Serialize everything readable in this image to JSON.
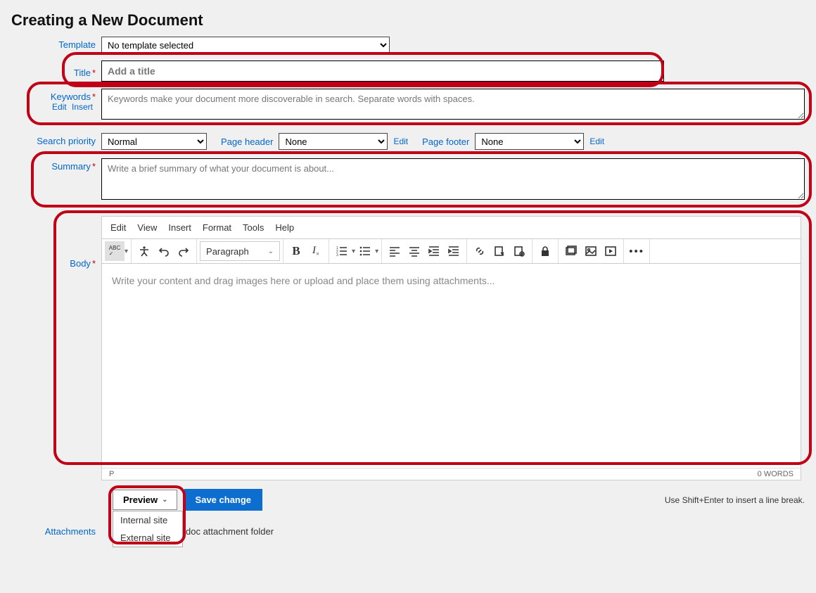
{
  "page_title": "Creating a New Document",
  "labels": {
    "template": "Template",
    "title": "Title",
    "keywords": "Keywords",
    "keywords_edit": "Edit",
    "keywords_insert": "Insert",
    "search_priority": "Search priority",
    "page_header": "Page header",
    "page_footer": "Page footer",
    "header_edit": "Edit",
    "footer_edit": "Edit",
    "summary": "Summary",
    "body": "Body",
    "attachments": "Attachments"
  },
  "template_select": {
    "selected": "No template selected"
  },
  "title_field": {
    "placeholder": "Add a title",
    "value": ""
  },
  "keywords_field": {
    "placeholder": "Keywords make your document more discoverable in search. Separate words with spaces.",
    "value": ""
  },
  "search_priority_select": {
    "selected": "Normal"
  },
  "page_header_select": {
    "selected": "None"
  },
  "page_footer_select": {
    "selected": "None"
  },
  "summary_field": {
    "placeholder": "Write a brief summary of what your document is about...",
    "value": ""
  },
  "editor": {
    "menus": [
      "Edit",
      "View",
      "Insert",
      "Format",
      "Tools",
      "Help"
    ],
    "paragraph_label": "Paragraph",
    "placeholder": "Write your content and drag images here or upload and place them using attachments...",
    "status_path": "P",
    "word_count": "0 WORDS",
    "toolbar_items": {
      "spellcheck": "abc-spellcheck",
      "accessibility": "accessibility",
      "undo": "undo",
      "redo": "redo",
      "bold": "bold",
      "clearformat": "clear-format",
      "numlist": "numbered-list",
      "bullist": "bullet-list",
      "alignleft": "align-left",
      "aligncenter": "align-center",
      "outdent": "outdent",
      "indent": "indent",
      "link": "link",
      "editlink": "edit-link",
      "doclink": "document-link",
      "lock": "lock",
      "image1": "image-gallery",
      "image2": "image",
      "video": "video",
      "more": "more"
    }
  },
  "actions": {
    "preview": "Preview",
    "save": "Save change",
    "hint": "Use Shift+Enter to insert a line break.",
    "preview_options": [
      "Internal site",
      "External site"
    ]
  },
  "attachments_text": "doc attachment folder"
}
